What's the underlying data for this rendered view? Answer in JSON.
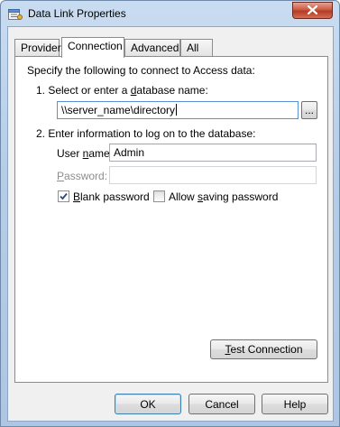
{
  "window": {
    "title": "Data Link Properties"
  },
  "tabs": [
    {
      "label": "Provider"
    },
    {
      "label": "Connection"
    },
    {
      "label": "Advanced"
    },
    {
      "label": "All"
    }
  ],
  "connection": {
    "intro": "Specify the following to connect to Access data:",
    "step1": {
      "pre": "1. Select or enter a ",
      "acc": "d",
      "post": "atabase name:"
    },
    "database_value": "\\\\server_name\\directory",
    "browse_label": "...",
    "step2": "2. Enter information to log on to the database:",
    "user_name": {
      "pre": "User ",
      "acc": "n",
      "post": "ame:",
      "value": "Admin"
    },
    "password": {
      "acc": "P",
      "post": "assword:",
      "value": ""
    },
    "blank_password": {
      "acc": "B",
      "post": "lank password",
      "checked": true
    },
    "allow_saving": {
      "pre": "Allow ",
      "acc": "s",
      "post": "aving password",
      "checked": false
    },
    "test_connection": {
      "acc": "T",
      "post": "est Connection"
    }
  },
  "footer": {
    "ok_label": "OK",
    "cancel_label": "Cancel",
    "help_label": "Help"
  }
}
